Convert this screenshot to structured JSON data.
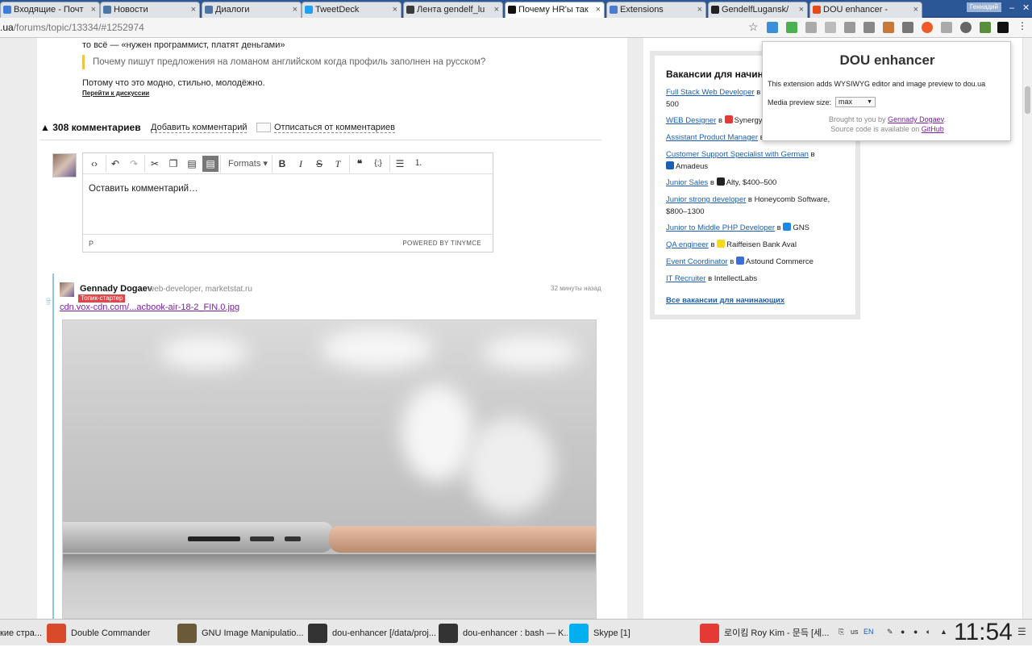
{
  "tabs": [
    {
      "title": "Входящие - Почт",
      "color": "#3b7dd8",
      "active": false
    },
    {
      "title": "Новости",
      "color": "#4a76a8",
      "active": false
    },
    {
      "title": "Диалоги",
      "color": "#4a76a8",
      "active": false
    },
    {
      "title": "TweetDeck",
      "color": "#1da1f2",
      "active": false
    },
    {
      "title": "Лента gendelf_lu",
      "color": "#3c3c3c",
      "active": false
    },
    {
      "title": "Почему HR'ы так",
      "color": "#111111",
      "active": true
    },
    {
      "title": "Extensions",
      "color": "#4a7bd0",
      "active": false
    },
    {
      "title": "GendelfLugansk/",
      "color": "#222222",
      "active": false
    },
    {
      "title": "DOU enhancer - ",
      "color": "#e64a19",
      "active": false
    }
  ],
  "user_badge": "Геннадий",
  "address": {
    "host": ".ua",
    "path": "/forums/topic/13334/#1252974"
  },
  "article": {
    "line1": "то всё — «нужен программист, платят деньгами»",
    "quote": "Почему пишут предложения на ломаном английском когда профиль заполнен на русском?",
    "line2": "Потому что это модно, стильно, молодёжно.",
    "to_discussion": "Перейти к дискуссии"
  },
  "comments_bar": {
    "count_label": "308 комментариев",
    "add_label": "Добавить комментарий",
    "unsubscribe_label": "Отписаться от комментариев"
  },
  "editor": {
    "formats_label": "Formats",
    "placeholder": "Оставить комментарий…",
    "path": "P",
    "powered": "POWERED BY TINYMCE"
  },
  "comment": {
    "author": "Gennady Dogaev",
    "meta": "web-developer, marketstat.ru",
    "time": "32 минуты назад",
    "badge": "Топик-стартер",
    "side_label": "up",
    "link": "cdn.vox-cdn.com/...acbook-air-18-2_FIN.0.jpg"
  },
  "jobs": {
    "heading": "Вакансии для начин",
    "items": [
      {
        "title": "Full Stack Web Developer",
        "rest": " в ",
        "company": "",
        "extra": "500",
        "color": "#e53935"
      },
      {
        "title": "WEB Designer",
        "rest": " в ",
        "company": "Synergy",
        "extra": "",
        "color": "#e53935"
      },
      {
        "title": "Assistant Product Manager",
        "rest": " в",
        "company": "",
        "extra": "",
        "color": ""
      },
      {
        "title": "Customer Support Specialist with German",
        "rest": " в",
        "company": "Amadeus",
        "extra": "",
        "color": "#1a5fb4"
      },
      {
        "title": "Junior Sales",
        "rest": " в ",
        "company": "Alty, $400–500",
        "extra": "",
        "color": "#222222"
      },
      {
        "title": "Junior strong developer",
        "rest": " в ",
        "company": "Honeycomb Software, $800–1300",
        "extra": "",
        "color": ""
      },
      {
        "title": "Junior to Middle PHP Developer",
        "rest": " в ",
        "company": "GNS",
        "extra": "",
        "color": "#1e88e5"
      },
      {
        "title": "QA engineer",
        "rest": " в ",
        "company": "Raiffeisen Bank Aval",
        "extra": "",
        "color": "#f9d71c"
      },
      {
        "title": "Event Coordinator",
        "rest": " в ",
        "company": "Astound Commerce",
        "extra": "",
        "color": "#3a6fd8"
      },
      {
        "title": "IT Recruiter",
        "rest": " в ",
        "company": "IntellectLabs",
        "extra": "",
        "color": ""
      }
    ],
    "all_label": "Все вакансии для начинающих"
  },
  "popup": {
    "title": "DOU enhancer",
    "description": "This extension adds WYSIWYG editor and image preview to dou.ua",
    "media_label": "Media preview size:",
    "media_value": "max",
    "brought": "Brought to you by ",
    "author_link": "Gennady Dogaev",
    "source": "Source code is available on ",
    "github": "GitHub"
  },
  "taskbar": {
    "items": [
      {
        "label": "кие стра...",
        "color": "#f0a020"
      },
      {
        "label": "Double Commander",
        "color": "#d84a2a"
      },
      {
        "label": "GNU Image Manipulatio...",
        "color": "#6b5a3a"
      },
      {
        "label": "dou-enhancer [/data/proj...",
        "color": "#333333"
      },
      {
        "label": "dou-enhancer : bash — K...",
        "color": "#333333"
      },
      {
        "label": "Skype [1]",
        "color": "#00aff0"
      },
      {
        "label": "로이킴 Roy Kim - 문득 [세...",
        "color": "#e53935"
      }
    ],
    "lang": "us",
    "lang2": "EN",
    "clock": "11:54"
  }
}
